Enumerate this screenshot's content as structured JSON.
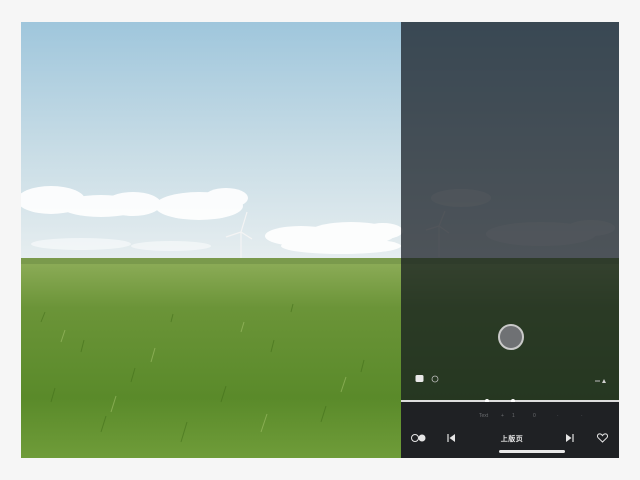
{
  "scene": {
    "description_icon": "landscape-photo",
    "sky_top_color": "#a8cbe0",
    "sky_bottom_color": "#e3ecef",
    "grass_color": "#5e8a2b"
  },
  "overlay": {
    "left_icon": "photo-icon",
    "timer_icon": "timer-icon",
    "right_icon": "flash-icon",
    "shutter_icon": "shutter-button"
  },
  "controls": {
    "faint_row": [
      "Text",
      "+",
      "1",
      "0",
      "·",
      "·"
    ],
    "left_icon": "effects-icon",
    "prev_icon": "skip-back-icon",
    "center_label": "上版页",
    "next_icon": "skip-forward-icon",
    "favorite_icon": "heart-icon"
  }
}
